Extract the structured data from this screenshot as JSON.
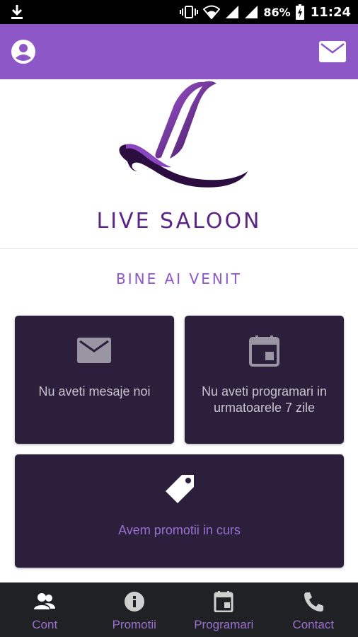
{
  "status_bar": {
    "battery": "86%",
    "time": "11:24",
    "icons": [
      "download-icon",
      "vibrate-icon",
      "wifi-icon",
      "signal-icon",
      "signal-icon",
      "battery-charging-icon"
    ]
  },
  "app_bar": {
    "left_icon": "account-circle-icon",
    "right_icon": "mail-icon",
    "color": "#8e57c7"
  },
  "brand": {
    "name": "LIVE SALOON",
    "logo_icon": "live-saloon-l-logo"
  },
  "welcome": "BINE AI VENIT",
  "cards": {
    "messages": {
      "icon": "mail-icon",
      "text": "Nu aveti mesaje noi"
    },
    "appointments": {
      "icon": "calendar-icon",
      "text": "Nu aveti programari in urmatoarele 7 zile"
    },
    "promotions": {
      "icon": "tag-icon",
      "text": "Avem promotii in curs"
    }
  },
  "bottom_nav": [
    {
      "label": "Cont",
      "icon": "people-icon"
    },
    {
      "label": "Promotii",
      "icon": "info-icon"
    },
    {
      "label": "Programari",
      "icon": "calendar-icon"
    },
    {
      "label": "Contact",
      "icon": "phone-icon"
    }
  ],
  "colors": {
    "accent": "#8e57c7",
    "brand_text": "#5a2585",
    "card_bg": "#2c1f3c",
    "nav_bg": "#202124"
  }
}
